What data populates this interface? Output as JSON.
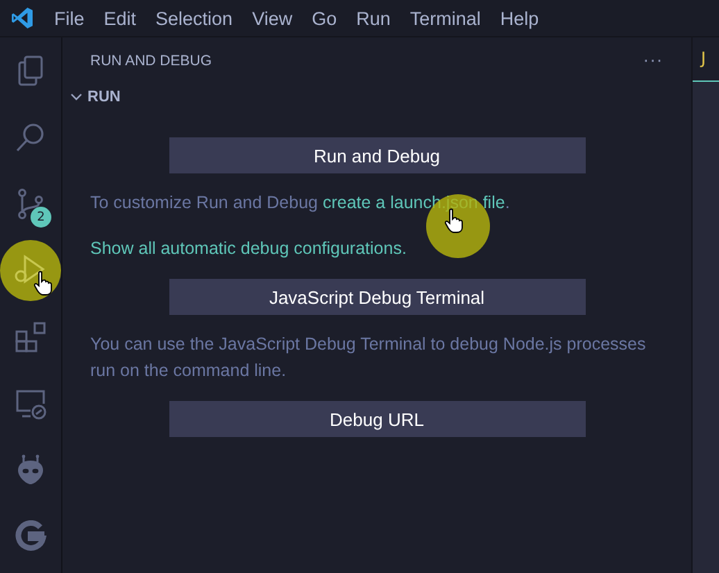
{
  "menu_bar": {
    "items": [
      "File",
      "Edit",
      "Selection",
      "View",
      "Go",
      "Run",
      "Terminal",
      "Help"
    ]
  },
  "activity_bar": {
    "items": [
      {
        "kind": "files",
        "selected": false
      },
      {
        "kind": "search",
        "selected": false
      },
      {
        "kind": "source-control",
        "selected": false,
        "badge": "2"
      },
      {
        "kind": "run-debug",
        "selected": true
      },
      {
        "kind": "extensions",
        "selected": false
      },
      {
        "kind": "remote",
        "selected": false
      },
      {
        "kind": "alien",
        "selected": false
      },
      {
        "kind": "g-logo",
        "selected": false
      }
    ]
  },
  "sidebar": {
    "title": "RUN AND DEBUG",
    "more": "···",
    "section": {
      "title": "RUN",
      "expanded": true
    },
    "content": [
      {
        "kind": "button",
        "text": "Run and Debug"
      },
      {
        "kind": "text",
        "text": "To customize Run and Debug ",
        "link": "create a launch.json file",
        "after": "."
      },
      {
        "kind": "link",
        "text": "Show all automatic debug configurations."
      },
      {
        "kind": "button",
        "text": "JavaScript Debug Terminal"
      },
      {
        "kind": "text",
        "text": "You can use the JavaScript Debug Terminal to debug Node.js processes run on the command line."
      },
      {
        "kind": "button",
        "text": "Debug URL"
      }
    ]
  },
  "editor": {
    "tab": "J"
  }
}
